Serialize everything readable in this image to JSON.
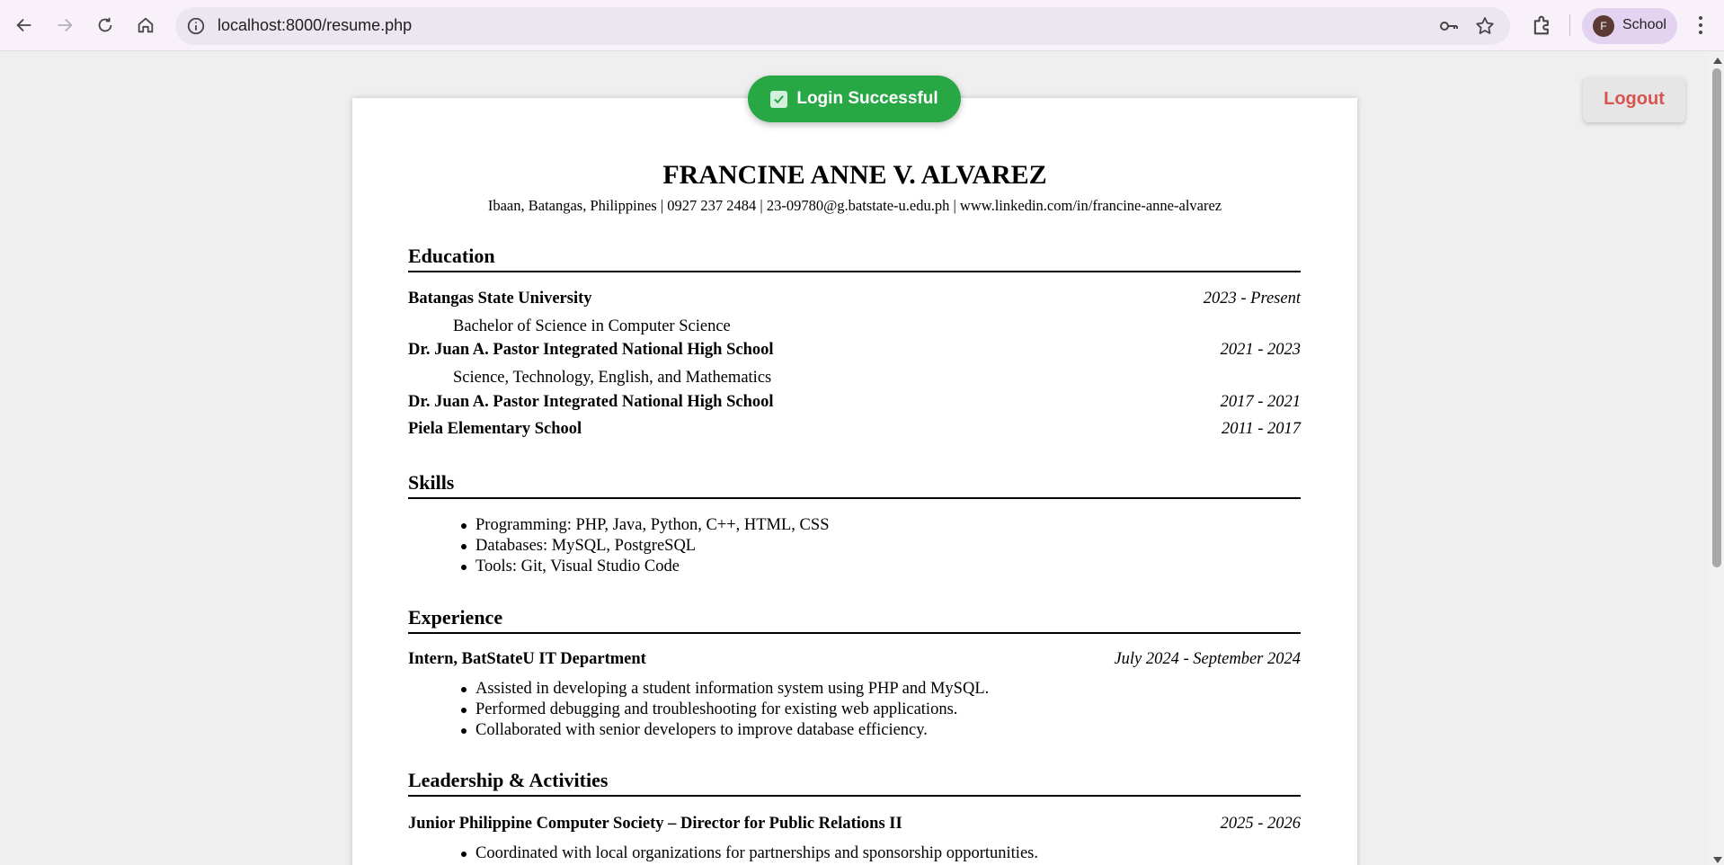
{
  "browser": {
    "url": "localhost:8000/resume.php",
    "profile_initial": "F",
    "profile_name": "School"
  },
  "toast": {
    "label": "Login Successful"
  },
  "logout_label": "Logout",
  "resume": {
    "name": "FRANCINE ANNE V. ALVAREZ",
    "contact": "Ibaan, Batangas, Philippines | 0927 237 2484 | 23-09780@g.batstate-u.edu.ph | www.linkedin.com/in/francine-anne-alvarez",
    "education": {
      "title": "Education",
      "entries": [
        {
          "school": "Batangas State University",
          "dates": "2023 - Present",
          "detail": "Bachelor of Science in Computer Science"
        },
        {
          "school": "Dr. Juan A. Pastor Integrated National High School",
          "dates": "2021 - 2023",
          "detail": "Science, Technology, English, and Mathematics"
        },
        {
          "school": "Dr. Juan A. Pastor Integrated National High School",
          "dates": "2017 - 2021"
        },
        {
          "school": "Piela Elementary School",
          "dates": "2011 - 2017"
        }
      ]
    },
    "skills": {
      "title": "Skills",
      "items": [
        "Programming: PHP, Java, Python, C++, HTML, CSS",
        "Databases: MySQL, PostgreSQL",
        "Tools: Git, Visual Studio Code"
      ]
    },
    "experience": {
      "title": "Experience",
      "role": "Intern, BatStateU IT Department",
      "dates": "July 2024 - September 2024",
      "items": [
        "Assisted in developing a student information system using PHP and MySQL.",
        "Performed debugging and troubleshooting for existing web applications.",
        "Collaborated with senior developers to improve database efficiency."
      ]
    },
    "leadership": {
      "title": "Leadership & Activities",
      "role": "Junior Philippine Computer Society – Director for Public Relations II",
      "dates": "2025 - 2026",
      "items": [
        "Coordinated with local organizations for partnerships and sponsorship opportunities."
      ]
    }
  }
}
